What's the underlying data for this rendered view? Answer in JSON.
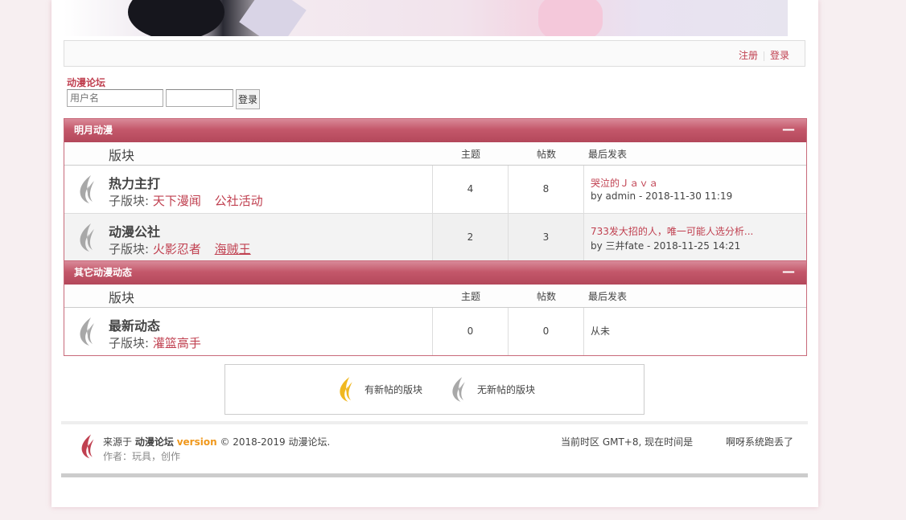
{
  "topbar": {
    "register": "注册",
    "login": "登录"
  },
  "forum_link": "动漫论坛",
  "login_form": {
    "username_placeholder": "用户名",
    "password_value": "",
    "submit": "登录"
  },
  "columns": {
    "board": "版块",
    "topics": "主题",
    "posts": "帖数",
    "last_post": "最后发表"
  },
  "categories": [
    {
      "title": "明月动漫",
      "toggle": "—",
      "forums": [
        {
          "name": "热力主打",
          "sub_label": "子版块:",
          "subforums": [
            "天下漫闻",
            "公社活动"
          ],
          "topics": "4",
          "posts": "8",
          "last_title": "哭泣的Ｊａｖａ",
          "last_by": "by admin - 2018-11-30 11:19"
        },
        {
          "name": "动漫公社",
          "sub_label": "子版块:",
          "subforums": [
            "火影忍者",
            "海贼王"
          ],
          "topics": "2",
          "posts": "3",
          "last_title": "733发大招的人，唯一可能人选分析...",
          "last_by": "by 三井fate - 2018-11-25 14:21"
        }
      ]
    },
    {
      "title": "其它动漫动态",
      "toggle": "—",
      "forums": [
        {
          "name": "最新动态",
          "sub_label": "子版块:",
          "subforums": [
            "灌篮高手"
          ],
          "topics": "0",
          "posts": "0",
          "last_none": "从未"
        }
      ]
    }
  ],
  "legend": {
    "new": "有新帖的版块",
    "none": "无新帖的版块"
  },
  "footer": {
    "powered_prefix": "来源于",
    "forum_name": "动漫论坛",
    "version": "version",
    "copyright": "© 2018-2019 动漫论坛.",
    "author": "作者：玩具，创作",
    "timezone": "当前时区 GMT+8, 现在时间是",
    "error": "啊呀系统跑丢了"
  },
  "colors": {
    "accent": "#c04050",
    "header_red": "#c4586b",
    "version_orange": "#f0981c"
  }
}
